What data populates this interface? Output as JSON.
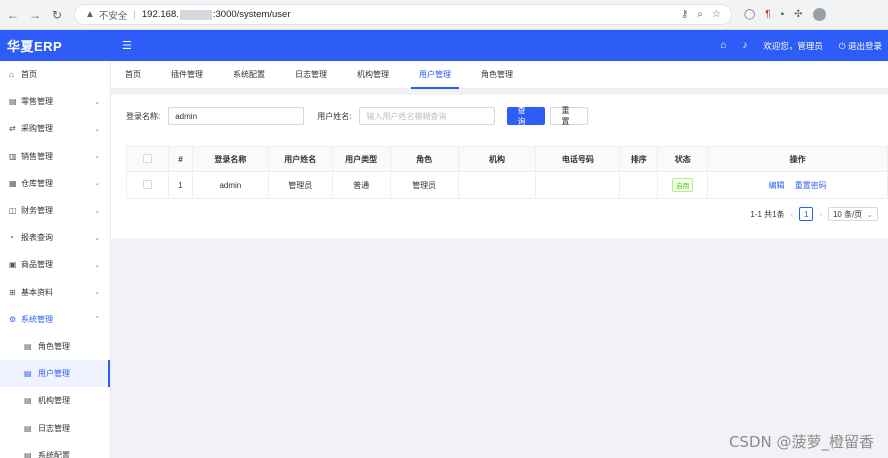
{
  "browser": {
    "back": "←",
    "forward": "→",
    "reload": "↻",
    "warning_icon": "▲",
    "insecure_label": "不安全",
    "url_prefix": "192.168.",
    "url_suffix": ":3000/system/user"
  },
  "app": {
    "logo": "华夏ERP",
    "welcome": "欢迎您，管理员",
    "logout": "退出登录"
  },
  "sidebar": {
    "items": [
      {
        "icon": "⌂",
        "label": "首页"
      },
      {
        "icon": "▤",
        "label": "零售管理"
      },
      {
        "icon": "⇄",
        "label": "采购管理"
      },
      {
        "icon": "▥",
        "label": "销售管理"
      },
      {
        "icon": "▦",
        "label": "仓库管理"
      },
      {
        "icon": "◫",
        "label": "财务管理"
      },
      {
        "icon": "◔",
        "label": "报表查询"
      },
      {
        "icon": "▣",
        "label": "商品管理"
      },
      {
        "icon": "⊞",
        "label": "基本资料"
      },
      {
        "icon": "⚙",
        "label": "系统管理"
      }
    ],
    "sub_items": [
      {
        "icon": "▤",
        "label": "角色管理"
      },
      {
        "icon": "▤",
        "label": "用户管理"
      },
      {
        "icon": "▤",
        "label": "机构管理"
      },
      {
        "icon": "▤",
        "label": "日志管理"
      },
      {
        "icon": "▤",
        "label": "系统配置"
      }
    ]
  },
  "tabs": [
    "首页",
    "插件管理",
    "系统配置",
    "日志管理",
    "机构管理",
    "用户管理",
    "角色管理"
  ],
  "search": {
    "login_label": "登录名称:",
    "login_value": "admin",
    "name_label": "用户姓名:",
    "name_placeholder": "输入用户姓名模糊查询",
    "query_button": "查 询",
    "reset_button": "重 置"
  },
  "table": {
    "headers": [
      "#",
      "登录名称",
      "用户姓名",
      "用户类型",
      "角色",
      "机构",
      "电话号码",
      "排序",
      "状态",
      "操作"
    ],
    "rows": [
      {
        "index": "1",
        "login": "admin",
        "name": "管理员",
        "type": "普通",
        "role": "管理员",
        "org": "",
        "phone": "",
        "sort": "",
        "status": "启用",
        "edit": "编辑",
        "reset_pwd": "重置密码"
      }
    ]
  },
  "pagination": {
    "summary": "1-1 共1条",
    "current_page": "1",
    "page_size": "10 条/页"
  },
  "watermark": "CSDN @菠萝_橙留香",
  "colors": {
    "primary": "#2d5cf6",
    "status_green": "#52c41a"
  }
}
